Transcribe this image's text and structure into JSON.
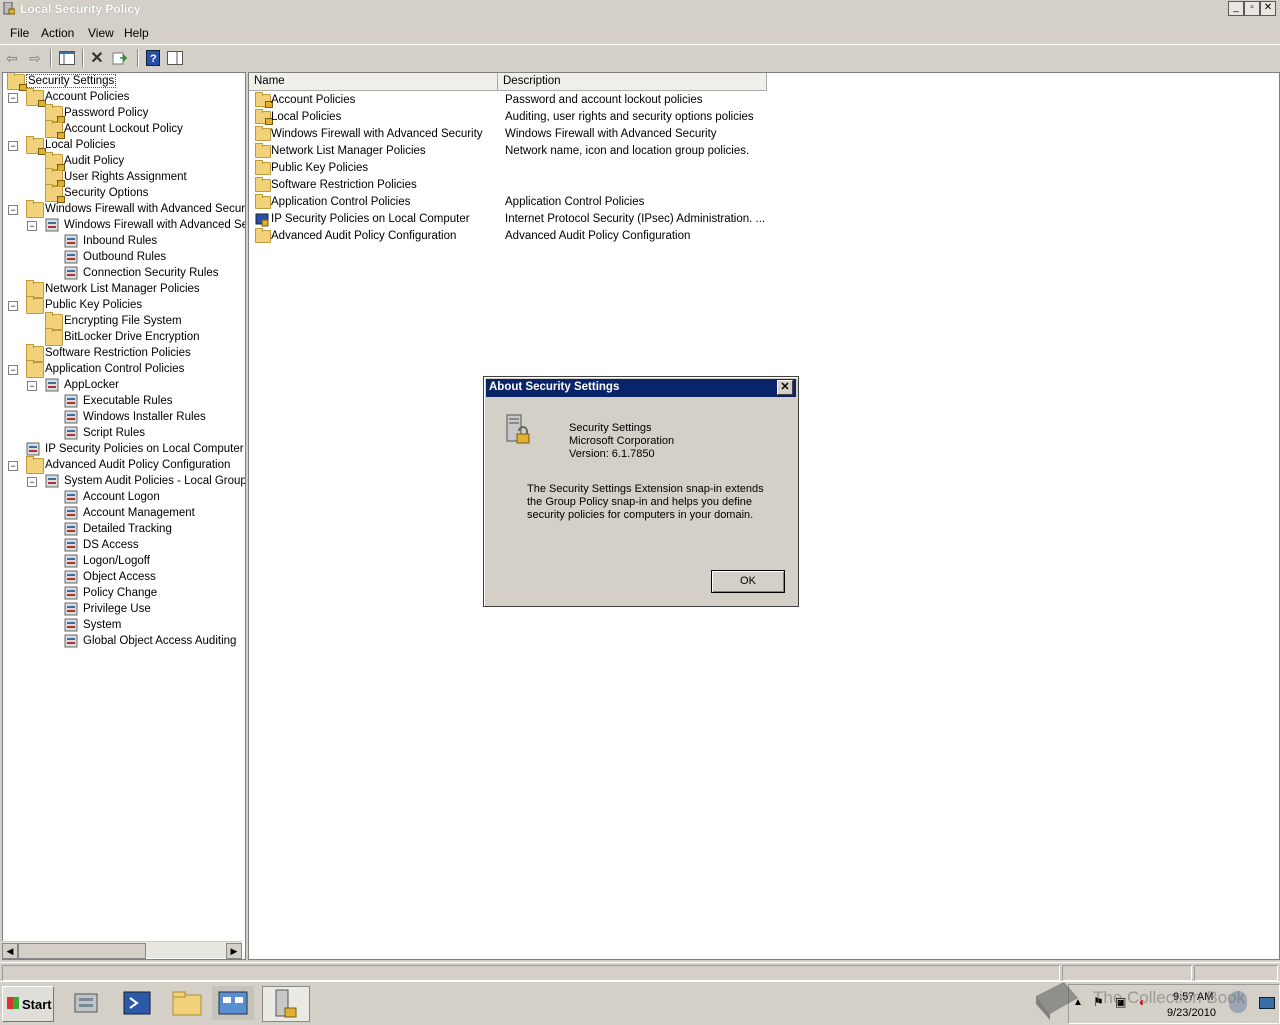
{
  "window": {
    "title": "Local Security Policy",
    "minimize": "_",
    "restore": "▫",
    "close": "✕"
  },
  "menu": [
    "File",
    "Action",
    "View",
    "Help"
  ],
  "tree": [
    {
      "label": "Security Settings",
      "level": 0,
      "expander": "",
      "icon": "lock-folder-icon",
      "selected": true
    },
    {
      "label": "Account Policies",
      "level": 1,
      "expander": "−",
      "icon": "lock-folder-icon"
    },
    {
      "label": "Password Policy",
      "level": 2,
      "expander": "",
      "icon": "lock-folder-icon"
    },
    {
      "label": "Account Lockout Policy",
      "level": 2,
      "expander": "",
      "icon": "lock-folder-icon"
    },
    {
      "label": "Local Policies",
      "level": 1,
      "expander": "−",
      "icon": "lock-folder-icon"
    },
    {
      "label": "Audit Policy",
      "level": 2,
      "expander": "",
      "icon": "lock-folder-icon"
    },
    {
      "label": "User Rights Assignment",
      "level": 2,
      "expander": "",
      "icon": "lock-folder-icon"
    },
    {
      "label": "Security Options",
      "level": 2,
      "expander": "",
      "icon": "lock-folder-icon"
    },
    {
      "label": "Windows Firewall with Advanced Security",
      "level": 1,
      "expander": "−",
      "icon": "folder-icon"
    },
    {
      "label": "Windows Firewall with Advanced Secu",
      "level": 2,
      "expander": "−",
      "icon": "firewall-icon"
    },
    {
      "label": "Inbound Rules",
      "level": 3,
      "expander": "",
      "icon": "inbound-rules-icon"
    },
    {
      "label": "Outbound Rules",
      "level": 3,
      "expander": "",
      "icon": "outbound-rules-icon"
    },
    {
      "label": "Connection Security Rules",
      "level": 3,
      "expander": "",
      "icon": "connection-rules-icon"
    },
    {
      "label": "Network List Manager Policies",
      "level": 1,
      "expander": "",
      "icon": "folder-icon"
    },
    {
      "label": "Public Key Policies",
      "level": 1,
      "expander": "−",
      "icon": "folder-icon"
    },
    {
      "label": "Encrypting File System",
      "level": 2,
      "expander": "",
      "icon": "folder-icon"
    },
    {
      "label": "BitLocker Drive Encryption",
      "level": 2,
      "expander": "",
      "icon": "folder-icon"
    },
    {
      "label": "Software Restriction Policies",
      "level": 1,
      "expander": "",
      "icon": "folder-icon"
    },
    {
      "label": "Application Control Policies",
      "level": 1,
      "expander": "−",
      "icon": "folder-icon"
    },
    {
      "label": "AppLocker",
      "level": 2,
      "expander": "−",
      "icon": "applocker-icon"
    },
    {
      "label": "Executable Rules",
      "level": 3,
      "expander": "",
      "icon": "rules-icon"
    },
    {
      "label": "Windows Installer Rules",
      "level": 3,
      "expander": "",
      "icon": "installer-rules-icon"
    },
    {
      "label": "Script Rules",
      "level": 3,
      "expander": "",
      "icon": "script-rules-icon"
    },
    {
      "label": "IP Security Policies on Local Computer",
      "level": 1,
      "expander": "",
      "icon": "ipsec-icon"
    },
    {
      "label": "Advanced Audit Policy Configuration",
      "level": 1,
      "expander": "−",
      "icon": "folder-icon"
    },
    {
      "label": "System Audit Policies - Local Group Po",
      "level": 2,
      "expander": "−",
      "icon": "audit-policies-icon"
    },
    {
      "label": "Account Logon",
      "level": 3,
      "expander": "",
      "icon": "audit-category-icon"
    },
    {
      "label": "Account Management",
      "level": 3,
      "expander": "",
      "icon": "audit-category-icon"
    },
    {
      "label": "Detailed Tracking",
      "level": 3,
      "expander": "",
      "icon": "audit-category-icon"
    },
    {
      "label": "DS Access",
      "level": 3,
      "expander": "",
      "icon": "audit-category-icon"
    },
    {
      "label": "Logon/Logoff",
      "level": 3,
      "expander": "",
      "icon": "audit-category-icon"
    },
    {
      "label": "Object Access",
      "level": 3,
      "expander": "",
      "icon": "audit-category-icon"
    },
    {
      "label": "Policy Change",
      "level": 3,
      "expander": "",
      "icon": "audit-category-icon"
    },
    {
      "label": "Privilege Use",
      "level": 3,
      "expander": "",
      "icon": "audit-category-icon"
    },
    {
      "label": "System",
      "level": 3,
      "expander": "",
      "icon": "audit-category-icon"
    },
    {
      "label": "Global Object Access Auditing",
      "level": 3,
      "expander": "",
      "icon": "audit-category-icon"
    }
  ],
  "list": {
    "columns": [
      "Name",
      "Description"
    ],
    "rows": [
      {
        "name": "Account Policies",
        "description": "Password and account lockout policies",
        "icon": "lock-folder-icon"
      },
      {
        "name": "Local Policies",
        "description": "Auditing, user rights and security options policies",
        "icon": "lock-folder-icon"
      },
      {
        "name": "Windows Firewall with Advanced Security",
        "description": "Windows Firewall with Advanced Security",
        "icon": "folder-icon"
      },
      {
        "name": "Network List Manager Policies",
        "description": "Network name, icon and location group policies.",
        "icon": "folder-icon"
      },
      {
        "name": "Public Key Policies",
        "description": "",
        "icon": "folder-icon"
      },
      {
        "name": "Software Restriction Policies",
        "description": "",
        "icon": "folder-icon"
      },
      {
        "name": "Application Control Policies",
        "description": "Application Control Policies",
        "icon": "folder-icon"
      },
      {
        "name": "IP Security Policies on Local Computer",
        "description": "Internet Protocol Security (IPsec) Administration. ...",
        "icon": "ipsec-icon"
      },
      {
        "name": "Advanced Audit Policy Configuration",
        "description": "Advanced Audit Policy Configuration",
        "icon": "folder-icon"
      }
    ]
  },
  "dialog": {
    "title": "About Security Settings",
    "close": "✕",
    "product": "Security Settings",
    "company": "Microsoft Corporation",
    "version": "Version: 6.1.7850",
    "desc1": "The Security Settings Extension snap-in extends",
    "desc2": "the Group Policy snap-in and helps you define",
    "desc3": "security policies for computers in your domain.",
    "ok": "OK"
  },
  "taskbar": {
    "start": "Start",
    "time": "9:57 AM",
    "date": "9/23/2010"
  },
  "watermark": "The Collection Book",
  "colors": {
    "dialog_title": "#0a246a",
    "folder": "#f1d27a",
    "face": "#d4d0c8"
  }
}
